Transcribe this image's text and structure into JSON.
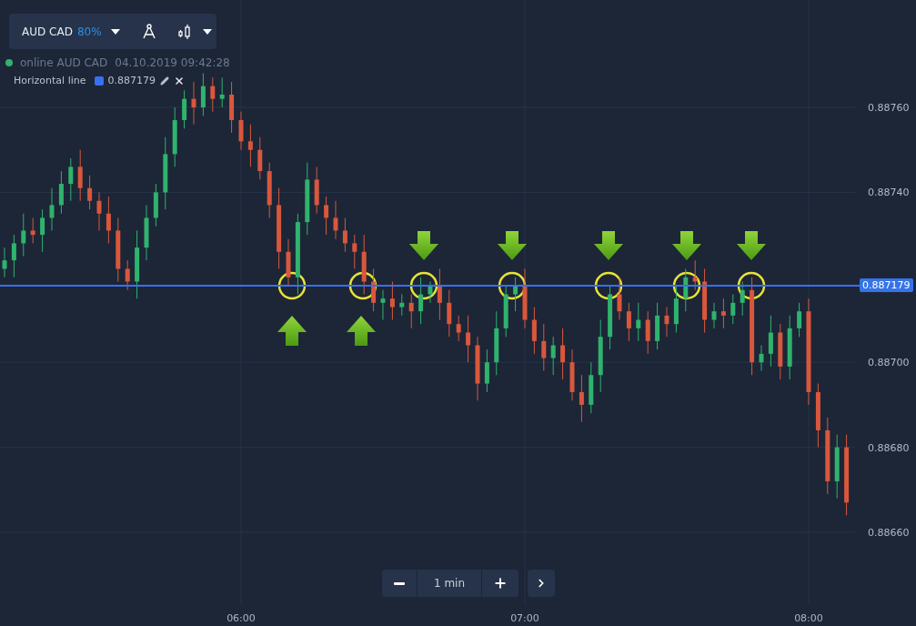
{
  "toolbar": {
    "pair": "AUD CAD",
    "payout": "80%"
  },
  "status": {
    "online": true,
    "text": "online AUD CAD",
    "datetime": "04.10.2019 09:42:28"
  },
  "drawing": {
    "label": "Horizontal line",
    "value": "0.887179"
  },
  "chart_data": {
    "type": "candlestick",
    "categories": [
      null,
      null,
      null,
      null,
      null,
      null,
      null,
      null,
      null,
      null,
      null,
      null,
      null,
      null,
      null,
      null,
      null,
      null,
      null,
      null,
      null,
      null,
      null,
      null,
      null,
      "06:00",
      null,
      null,
      null,
      null,
      null,
      null,
      null,
      null,
      null,
      null,
      null,
      null,
      null,
      null,
      null,
      null,
      null,
      null,
      null,
      null,
      null,
      null,
      null,
      null,
      null,
      null,
      null,
      null,
      null,
      "07:00",
      null,
      null,
      null,
      null,
      null,
      null,
      null,
      null,
      null,
      null,
      null,
      null,
      null,
      null,
      null,
      null,
      null,
      null,
      null,
      null,
      null,
      null,
      null,
      null,
      null,
      null,
      null,
      null,
      null,
      "08:00",
      null,
      null,
      null,
      null
    ],
    "grid": true,
    "ylim": [
      0.8866,
      0.8876
    ],
    "yticks": [
      {
        "value": 0.8876,
        "label": "0.88760"
      },
      {
        "value": 0.8874,
        "label": "0.88740"
      },
      {
        "value": 0.887,
        "label": "0.88700"
      },
      {
        "value": 0.8868,
        "label": "0.88680"
      },
      {
        "value": 0.8866,
        "label": "0.88660"
      }
    ],
    "ohlc": [
      [
        0.88722,
        0.88727,
        0.8872,
        0.88724
      ],
      [
        0.88724,
        0.8873,
        0.8872,
        0.88728
      ],
      [
        0.88728,
        0.88735,
        0.88725,
        0.88731
      ],
      [
        0.88731,
        0.88734,
        0.88728,
        0.8873
      ],
      [
        0.8873,
        0.88736,
        0.88726,
        0.88734
      ],
      [
        0.88734,
        0.88741,
        0.88731,
        0.88737
      ],
      [
        0.88737,
        0.88745,
        0.88735,
        0.88742
      ],
      [
        0.88742,
        0.88748,
        0.88738,
        0.88746
      ],
      [
        0.88746,
        0.8875,
        0.88738,
        0.88741
      ],
      [
        0.88741,
        0.88744,
        0.88736,
        0.88738
      ],
      [
        0.88738,
        0.8874,
        0.88731,
        0.88735
      ],
      [
        0.88735,
        0.88739,
        0.88728,
        0.88731
      ],
      [
        0.88731,
        0.88734,
        0.88719,
        0.88722
      ],
      [
        0.88722,
        0.88724,
        0.88717,
        0.88719
      ],
      [
        0.88719,
        0.88731,
        0.88715,
        0.88727
      ],
      [
        0.88727,
        0.88737,
        0.88724,
        0.88734
      ],
      [
        0.88734,
        0.88742,
        0.88732,
        0.8874
      ],
      [
        0.8874,
        0.88753,
        0.88736,
        0.88749
      ],
      [
        0.88749,
        0.8876,
        0.88746,
        0.88757
      ],
      [
        0.88757,
        0.88764,
        0.88755,
        0.88762
      ],
      [
        0.88762,
        0.88766,
        0.88756,
        0.8876
      ],
      [
        0.8876,
        0.88768,
        0.88758,
        0.88765
      ],
      [
        0.88765,
        0.88767,
        0.88759,
        0.88762
      ],
      [
        0.88762,
        0.88767,
        0.8876,
        0.88763
      ],
      [
        0.88763,
        0.88766,
        0.88754,
        0.88757
      ],
      [
        0.88757,
        0.88759,
        0.8875,
        0.88752
      ],
      [
        0.88752,
        0.88756,
        0.88746,
        0.8875
      ],
      [
        0.8875,
        0.88753,
        0.88743,
        0.88745
      ],
      [
        0.88745,
        0.88747,
        0.88734,
        0.88737
      ],
      [
        0.88737,
        0.88741,
        0.88722,
        0.88726
      ],
      [
        0.88726,
        0.88729,
        0.88718,
        0.8872
      ],
      [
        0.8872,
        0.88735,
        0.88716,
        0.88733
      ],
      [
        0.88733,
        0.88747,
        0.8873,
        0.88743
      ],
      [
        0.88743,
        0.88746,
        0.88735,
        0.88737
      ],
      [
        0.88737,
        0.88739,
        0.8873,
        0.88734
      ],
      [
        0.88734,
        0.88738,
        0.88729,
        0.88731
      ],
      [
        0.88731,
        0.88734,
        0.88726,
        0.88728
      ],
      [
        0.88728,
        0.8873,
        0.88722,
        0.88726
      ],
      [
        0.88726,
        0.8873,
        0.88716,
        0.88719
      ],
      [
        0.88719,
        0.88722,
        0.88712,
        0.88714
      ],
      [
        0.88714,
        0.88717,
        0.8871,
        0.88715
      ],
      [
        0.88715,
        0.88719,
        0.8871,
        0.88713
      ],
      [
        0.88713,
        0.88716,
        0.88711,
        0.88714
      ],
      [
        0.88714,
        0.88716,
        0.88708,
        0.88712
      ],
      [
        0.88712,
        0.8872,
        0.88709,
        0.88716
      ],
      [
        0.88716,
        0.88719,
        0.88714,
        0.88718
      ],
      [
        0.88718,
        0.88722,
        0.8871,
        0.88714
      ],
      [
        0.88714,
        0.88717,
        0.88706,
        0.88709
      ],
      [
        0.88709,
        0.88711,
        0.88705,
        0.88707
      ],
      [
        0.88707,
        0.88711,
        0.887,
        0.88704
      ],
      [
        0.88704,
        0.88706,
        0.88691,
        0.88695
      ],
      [
        0.88695,
        0.88703,
        0.88693,
        0.887
      ],
      [
        0.887,
        0.88712,
        0.88697,
        0.88708
      ],
      [
        0.88708,
        0.88718,
        0.88706,
        0.88716
      ],
      [
        0.88716,
        0.8872,
        0.88712,
        0.88718
      ],
      [
        0.88718,
        0.88722,
        0.88708,
        0.8871
      ],
      [
        0.8871,
        0.88713,
        0.88702,
        0.88705
      ],
      [
        0.88705,
        0.88709,
        0.88698,
        0.88701
      ],
      [
        0.88701,
        0.88706,
        0.88697,
        0.88704
      ],
      [
        0.88704,
        0.88708,
        0.88696,
        0.887
      ],
      [
        0.887,
        0.88703,
        0.88691,
        0.88693
      ],
      [
        0.88693,
        0.88697,
        0.88686,
        0.8869
      ],
      [
        0.8869,
        0.887,
        0.88688,
        0.88697
      ],
      [
        0.88697,
        0.8871,
        0.88693,
        0.88706
      ],
      [
        0.88706,
        0.88718,
        0.88703,
        0.88716
      ],
      [
        0.88716,
        0.8872,
        0.8871,
        0.88712
      ],
      [
        0.88712,
        0.88714,
        0.88705,
        0.88708
      ],
      [
        0.88708,
        0.88714,
        0.88705,
        0.8871
      ],
      [
        0.8871,
        0.88712,
        0.88702,
        0.88705
      ],
      [
        0.88705,
        0.88714,
        0.88703,
        0.88711
      ],
      [
        0.88711,
        0.88713,
        0.88706,
        0.88709
      ],
      [
        0.88709,
        0.88718,
        0.88707,
        0.88715
      ],
      [
        0.88715,
        0.88722,
        0.88712,
        0.8872
      ],
      [
        0.8872,
        0.88724,
        0.88717,
        0.88719
      ],
      [
        0.88719,
        0.88722,
        0.88707,
        0.8871
      ],
      [
        0.8871,
        0.88714,
        0.88708,
        0.88712
      ],
      [
        0.88712,
        0.88715,
        0.88708,
        0.88711
      ],
      [
        0.88711,
        0.88716,
        0.88709,
        0.88714
      ],
      [
        0.88714,
        0.88719,
        0.88711,
        0.88717
      ],
      [
        0.88717,
        0.8872,
        0.88697,
        0.887
      ],
      [
        0.887,
        0.88704,
        0.88698,
        0.88702
      ],
      [
        0.88702,
        0.88711,
        0.88699,
        0.88707
      ],
      [
        0.88707,
        0.88709,
        0.88696,
        0.88699
      ],
      [
        0.88699,
        0.88711,
        0.88696,
        0.88708
      ],
      [
        0.88708,
        0.88714,
        0.88706,
        0.88712
      ],
      [
        0.88712,
        0.88715,
        0.8869,
        0.88693
      ],
      [
        0.88693,
        0.88695,
        0.8868,
        0.88684
      ],
      [
        0.88684,
        0.88687,
        0.88669,
        0.88672
      ],
      [
        0.88672,
        0.88683,
        0.88668,
        0.8868
      ],
      [
        0.8868,
        0.88683,
        0.88664,
        0.88667
      ]
    ]
  },
  "price_badge": "0.887179",
  "timeframe": {
    "label": "1 min"
  }
}
